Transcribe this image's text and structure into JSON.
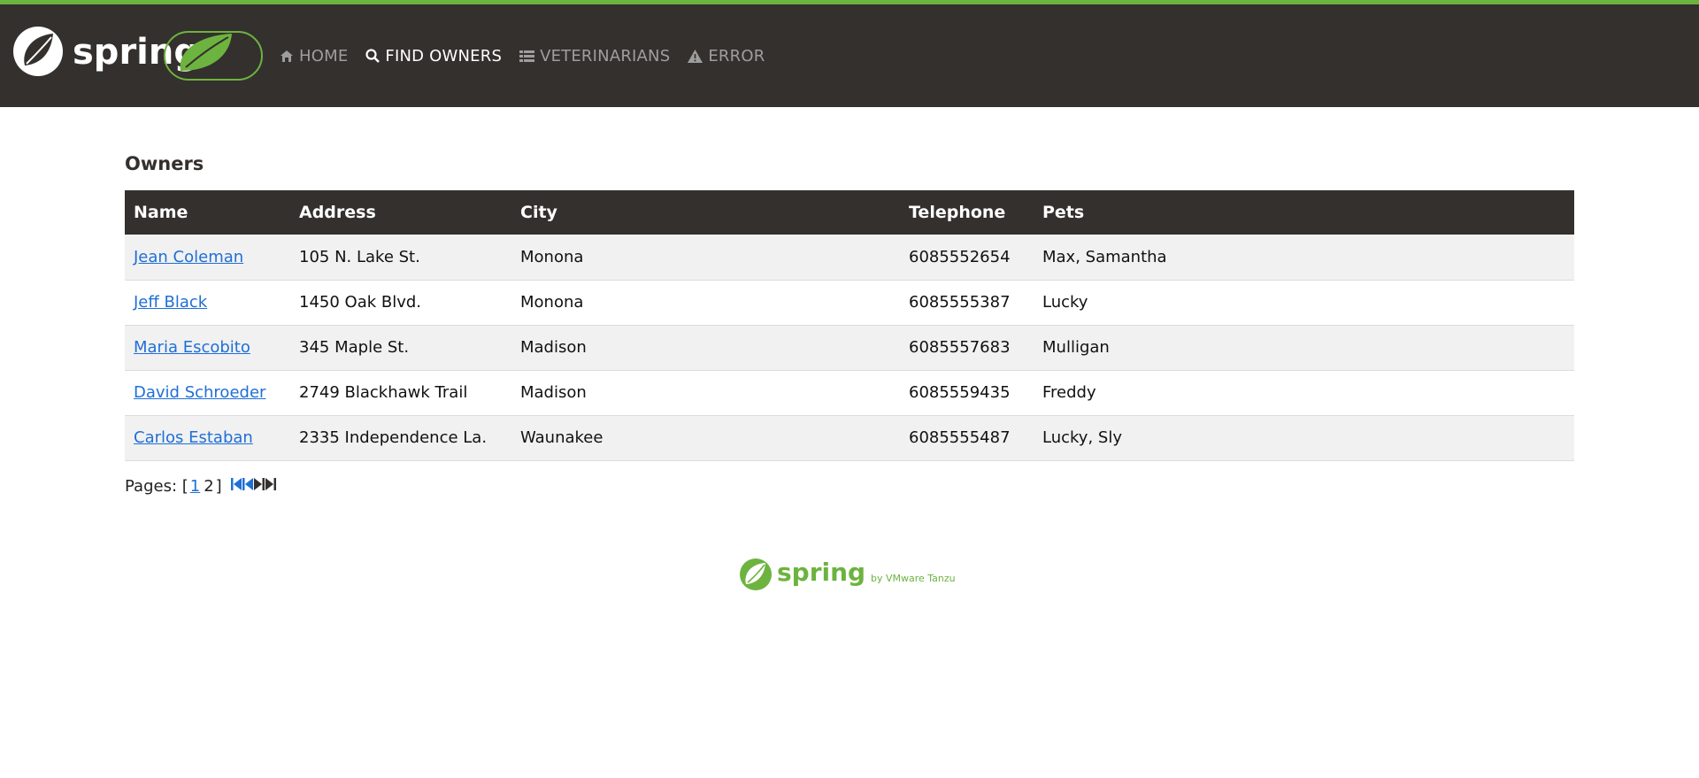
{
  "colors": {
    "accent": "#6db33f",
    "navbar": "#34302d",
    "link": "#1f6fd6"
  },
  "brand": {
    "logo_text": "spring"
  },
  "nav": [
    {
      "label": "HOME",
      "icon": "home-icon"
    },
    {
      "label": "FIND OWNERS",
      "icon": "search-icon",
      "active": true
    },
    {
      "label": "VETERINARIANS",
      "icon": "list-icon"
    },
    {
      "label": "ERROR",
      "icon": "warning-icon"
    }
  ],
  "page": {
    "title": "Owners"
  },
  "table": {
    "headers": [
      "Name",
      "Address",
      "City",
      "Telephone",
      "Pets"
    ],
    "rows": [
      {
        "name": "Jean Coleman",
        "address": "105 N. Lake St.",
        "city": "Monona",
        "telephone": "6085552654",
        "pets": "Max, Samantha"
      },
      {
        "name": "Jeff Black",
        "address": "1450 Oak Blvd.",
        "city": "Monona",
        "telephone": "6085555387",
        "pets": "Lucky"
      },
      {
        "name": "Maria Escobito",
        "address": "345 Maple St.",
        "city": "Madison",
        "telephone": "6085557683",
        "pets": "Mulligan"
      },
      {
        "name": "David Schroeder",
        "address": "2749 Blackhawk Trail",
        "city": "Madison",
        "telephone": "6085559435",
        "pets": "Freddy"
      },
      {
        "name": "Carlos Estaban",
        "address": "2335 Independence La.",
        "city": "Waunakee",
        "telephone": "6085555487",
        "pets": "Lucky, Sly"
      }
    ]
  },
  "pager": {
    "label": "Pages: [",
    "page1": "1",
    "page2": "2",
    "close": "]"
  },
  "footer": {
    "logo_text": "spring",
    "tagline": "by VMware Tanzu"
  }
}
